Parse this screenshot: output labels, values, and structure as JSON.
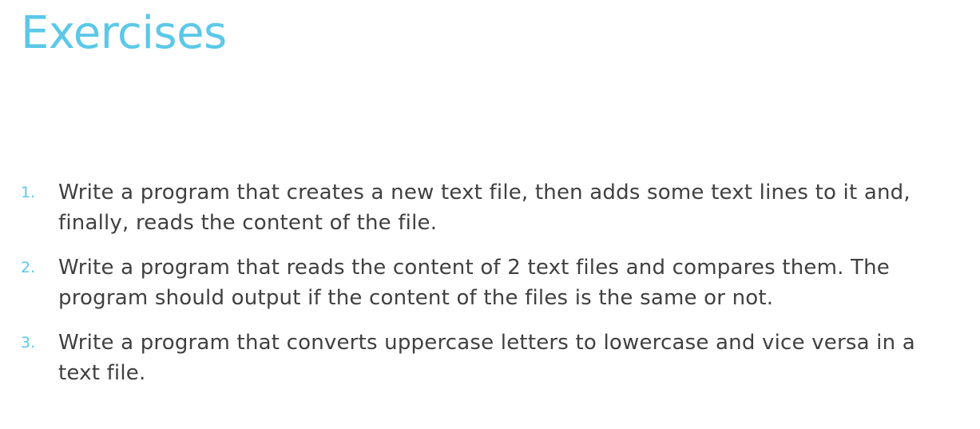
{
  "slide": {
    "title": "Exercises",
    "exercises": [
      {
        "number": "1.",
        "text": "Write a program that creates a new text file, then adds some text lines to it and, finally, reads the content of the file."
      },
      {
        "number": "2.",
        "text": "Write a program that reads the content of 2 text files and compares them. The program should output if the content of the files is the same or not."
      },
      {
        "number": "3.",
        "text": "Write a program that converts uppercase letters to lowercase and vice versa in a text file."
      }
    ]
  },
  "colors": {
    "accent": "#5bc8e8",
    "body_text": "#404040",
    "background": "#ffffff"
  }
}
